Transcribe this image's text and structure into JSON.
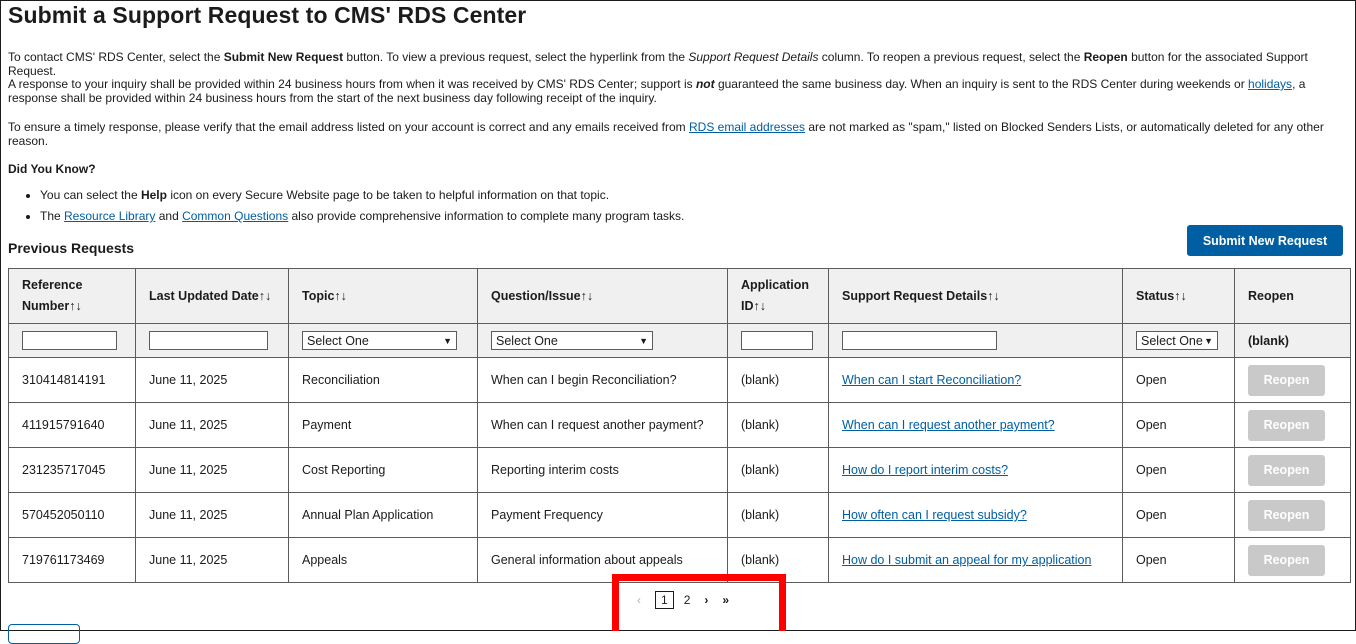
{
  "page_title": "Submit a Support Request to CMS' RDS Center",
  "intro": {
    "p1": {
      "t1": "To contact CMS' RDS Center, select the ",
      "b1": "Submit New Request",
      "t2": " button. To view a previous request, select the hyperlink from the ",
      "i1": "Support Request Details",
      "t3": " column. To reopen a previous request, select the ",
      "b2": "Reopen",
      "t4": " button for the associated Support Request."
    },
    "p2": {
      "t1": "A response to your inquiry shall be provided within 24 business hours from when it was received by CMS' RDS Center; support is ",
      "em": "not",
      "t2": " guaranteed the same business day. When an inquiry is sent to the RDS Center during weekends or ",
      "link": "holidays",
      "t3": ", a response shall be provided within 24 business hours from the start of the next business day following receipt of the inquiry."
    },
    "p3": {
      "t1": "To ensure a timely response, please verify that the email address listed on your account is correct and any emails received from ",
      "link": "RDS email addresses",
      "t2": " are not marked as \"spam,\" listed on Blocked Senders Lists, or automatically deleted for any other reason."
    }
  },
  "did_you_know": {
    "heading": "Did You Know?",
    "item1": {
      "t1": "You can select the ",
      "b": "Help",
      "t2": " icon on every Secure Website page to be taken to helpful information on that topic."
    },
    "item2": {
      "t1": "The ",
      "link1": "Resource Library",
      "t2": " and ",
      "link2": "Common Questions",
      "t3": " also provide comprehensive information to complete many program tasks."
    }
  },
  "previous_requests_title": "Previous Requests",
  "submit_button": "Submit New Request",
  "sort_glyph": "↑↓",
  "columns": [
    {
      "label": "Reference Number"
    },
    {
      "label": "Last Updated Date"
    },
    {
      "label": "Topic"
    },
    {
      "label": "Question/Issue"
    },
    {
      "label": "Application ID"
    },
    {
      "label": "Support Request Details"
    },
    {
      "label": "Status"
    },
    {
      "label": "Reopen"
    }
  ],
  "filters": {
    "topic_select": "Select One",
    "question_select": "Select One",
    "status_select": "Select One",
    "reopen_blank": "(blank)"
  },
  "rows": [
    {
      "ref": "310414814191",
      "date": "June 11, 2025",
      "topic": "Reconciliation",
      "question": "When can I begin Reconciliation?",
      "app_id": "(blank)",
      "details": "When can I start Reconciliation?",
      "status": "Open",
      "reopen": "Reopen"
    },
    {
      "ref": "411915791640",
      "date": "June 11, 2025",
      "topic": "Payment",
      "question": "When can I request another payment?",
      "app_id": "(blank)",
      "details": "When can I request another payment?",
      "status": "Open",
      "reopen": "Reopen"
    },
    {
      "ref": "231235717045",
      "date": "June 11, 2025",
      "topic": "Cost Reporting",
      "question": "Reporting interim costs",
      "app_id": "(blank)",
      "details": "How do I report interim costs?",
      "status": "Open",
      "reopen": "Reopen"
    },
    {
      "ref": "570452050110",
      "date": "June 11, 2025",
      "topic": "Annual Plan Application",
      "question": "Payment Frequency",
      "app_id": "(blank)",
      "details": "How often can I request subsidy?",
      "status": "Open",
      "reopen": "Reopen"
    },
    {
      "ref": "719761173469",
      "date": "June 11, 2025",
      "topic": "Appeals",
      "question": "General information about appeals",
      "app_id": "(blank)",
      "details": "How do I submit an appeal for my application",
      "status": "Open",
      "reopen": "Reopen"
    }
  ],
  "pagination": {
    "prev": "‹",
    "pages": [
      "1",
      "2"
    ],
    "current_page": "1",
    "next": "›",
    "last": "»"
  },
  "colors": {
    "primary": "#005ea2",
    "disabled": "#c9c9c9",
    "highlight": "#ff0000"
  }
}
